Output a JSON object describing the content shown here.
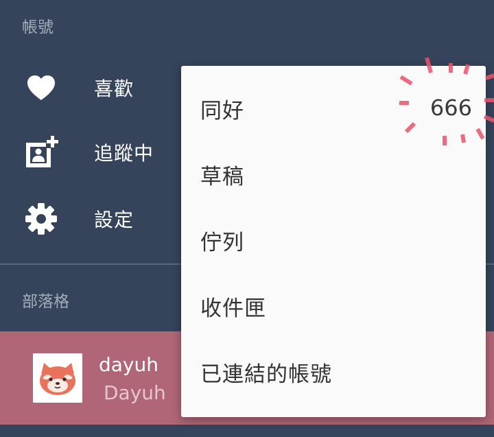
{
  "sidebar": {
    "account_header": "帳號",
    "items": [
      {
        "label": "喜歡",
        "icon": "heart-icon"
      },
      {
        "label": "追蹤中",
        "icon": "add-contact-icon"
      },
      {
        "label": "設定",
        "icon": "gear-icon"
      }
    ],
    "blogs_header": "部落格",
    "blog": {
      "name": "dayuh",
      "title": "Dayuh",
      "avatar": "red-panda-avatar"
    }
  },
  "menu": {
    "items": [
      {
        "label": "同好",
        "count": "666"
      },
      {
        "label": "草稿"
      },
      {
        "label": "佇列"
      },
      {
        "label": "收件匣"
      },
      {
        "label": "已連結的帳號"
      }
    ]
  },
  "colors": {
    "background": "#35445b",
    "blog_row": "#b06676",
    "menu_bg": "#fafafa",
    "burst": "#e9546b"
  }
}
